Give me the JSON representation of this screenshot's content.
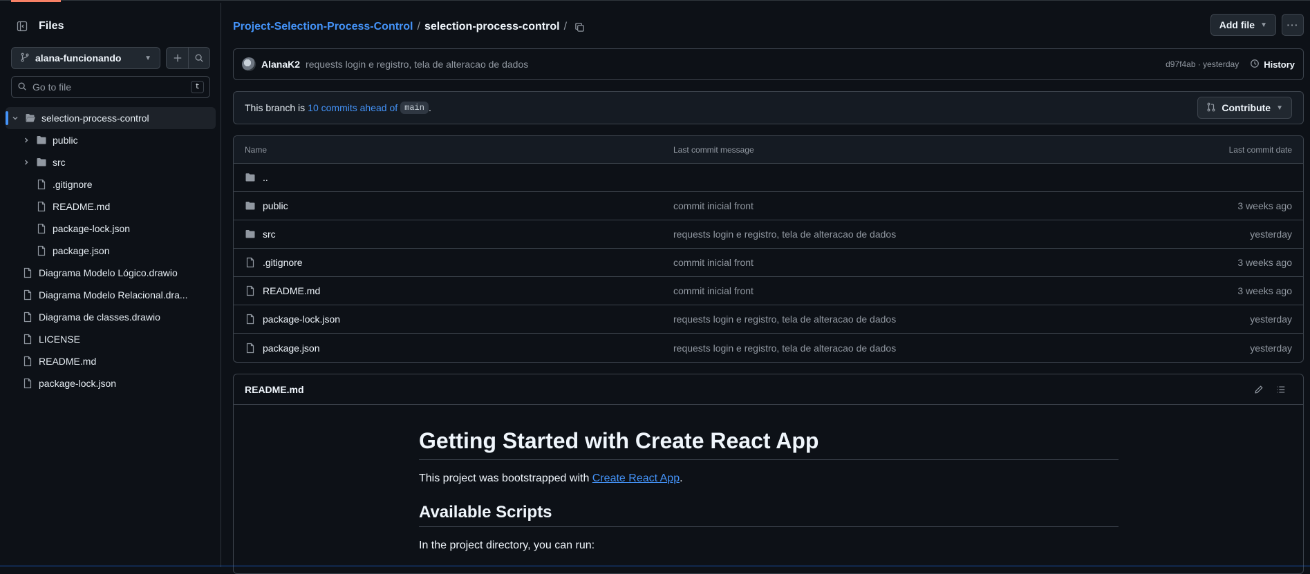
{
  "sidebar": {
    "title": "Files",
    "branch": "alana-funcionando",
    "search_placeholder": "Go to file",
    "search_shortcut": "t",
    "tree": [
      {
        "label": "selection-process-control",
        "type": "folder-open",
        "depth": 0,
        "expanded": true,
        "active": true
      },
      {
        "label": "public",
        "type": "folder",
        "depth": 1,
        "expanded": false
      },
      {
        "label": "src",
        "type": "folder",
        "depth": 1,
        "expanded": false
      },
      {
        "label": ".gitignore",
        "type": "file",
        "depth": 1
      },
      {
        "label": "README.md",
        "type": "file",
        "depth": 1
      },
      {
        "label": "package-lock.json",
        "type": "file",
        "depth": 1
      },
      {
        "label": "package.json",
        "type": "file",
        "depth": 1
      },
      {
        "label": "Diagrama Modelo Lógico.drawio",
        "type": "file",
        "depth": 0
      },
      {
        "label": "Diagrama Modelo Relacional.dra...",
        "type": "file",
        "depth": 0
      },
      {
        "label": "Diagrama de classes.drawio",
        "type": "file",
        "depth": 0
      },
      {
        "label": "LICENSE",
        "type": "file",
        "depth": 0
      },
      {
        "label": "README.md",
        "type": "file",
        "depth": 0
      },
      {
        "label": "package-lock.json",
        "type": "file",
        "depth": 0
      }
    ]
  },
  "breadcrumb": {
    "repo": "Project-Selection-Process-Control",
    "sep": "/",
    "current": "selection-process-control",
    "trail": "/"
  },
  "actions": {
    "add_file": "Add file"
  },
  "commit": {
    "author": "AlanaK2",
    "message": "requests login e registro, tela de alteracao de dados",
    "meta": "d97f4ab · yesterday",
    "history": "History"
  },
  "branch_status": {
    "prefix": "This branch is",
    "link": "10 commits ahead of",
    "base": "main",
    "suffix": ".",
    "contribute": "Contribute"
  },
  "files_table": {
    "headers": {
      "name": "Name",
      "message": "Last commit message",
      "date": "Last commit date"
    },
    "rows": [
      {
        "name": "..",
        "type": "folder",
        "message": "",
        "date": ""
      },
      {
        "name": "public",
        "type": "folder",
        "message": "commit inicial front",
        "date": "3 weeks ago"
      },
      {
        "name": "src",
        "type": "folder",
        "message": "requests login e registro, tela de alteracao de dados",
        "date": "yesterday"
      },
      {
        "name": ".gitignore",
        "type": "file",
        "message": "commit inicial front",
        "date": "3 weeks ago"
      },
      {
        "name": "README.md",
        "type": "file",
        "message": "commit inicial front",
        "date": "3 weeks ago"
      },
      {
        "name": "package-lock.json",
        "type": "file",
        "message": "requests login e registro, tela de alteracao de dados",
        "date": "yesterday"
      },
      {
        "name": "package.json",
        "type": "file",
        "message": "requests login e registro, tela de alteracao de dados",
        "date": "yesterday"
      }
    ]
  },
  "readme": {
    "filename": "README.md",
    "h1": "Getting Started with Create React App",
    "intro_prefix": "This project was bootstrapped with ",
    "intro_link": "Create React App",
    "intro_suffix": ".",
    "h2": "Available Scripts",
    "p2": "In the project directory, you can run:"
  },
  "colors": {
    "accent": "#4493f8",
    "background": "#0d1117",
    "border": "#3d444d",
    "tab_accent": "#f78166"
  }
}
